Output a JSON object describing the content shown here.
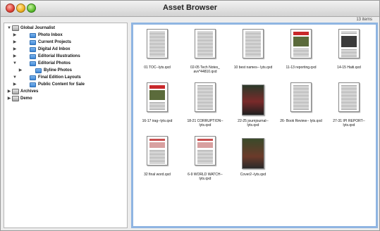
{
  "window": {
    "title": "Asset Browser",
    "item_count": "13 items"
  },
  "sidebar": {
    "items": [
      {
        "label": "Global Journalist",
        "type": "drive",
        "expanded": true,
        "indent": 0
      },
      {
        "label": "Photo Inbox",
        "type": "folder",
        "expanded": false,
        "indent": 1
      },
      {
        "label": "Current Projects",
        "type": "folder",
        "expanded": false,
        "indent": 1
      },
      {
        "label": "Digital Ad Inbox",
        "type": "folder",
        "expanded": false,
        "indent": 1
      },
      {
        "label": "Editorial Illustrations",
        "type": "folder",
        "expanded": false,
        "indent": 1
      },
      {
        "label": "Editorial Photos",
        "type": "folder",
        "expanded": true,
        "indent": 1
      },
      {
        "label": "Byline Photos",
        "type": "folder",
        "expanded": false,
        "indent": 2
      },
      {
        "label": "Final Edition Layouts",
        "type": "folder",
        "expanded": true,
        "indent": 1
      },
      {
        "label": "Public Content for Sale",
        "type": "folder",
        "expanded": false,
        "indent": 1
      },
      {
        "label": "Archives",
        "type": "drive",
        "expanded": false,
        "indent": 0
      },
      {
        "label": "Demo",
        "type": "drive",
        "expanded": false,
        "indent": 0
      }
    ]
  },
  "files": [
    {
      "name": "01 TOC--lyts.qxd",
      "kind": "text"
    },
    {
      "name": "02-05 Tech Notes_ avv*44810.qxd",
      "kind": "text"
    },
    {
      "name": "10 best names-- lyts.qxd",
      "kind": "text"
    },
    {
      "name": "11-13 reporting.qxd",
      "kind": "photo-red"
    },
    {
      "name": "14-15 Haiti.qxd",
      "kind": "photo"
    },
    {
      "name": "16-17 irag--lyts.qxd",
      "kind": "photo-red"
    },
    {
      "name": "18-21 CORRUPTION-- lyts.qxd",
      "kind": "text"
    },
    {
      "name": "22-25 journjournal-- lyts.qxd",
      "kind": "photo-dark"
    },
    {
      "name": "26- Book Review-- lyts.qxd",
      "kind": "text"
    },
    {
      "name": "27-31 IPI REPORT-- lyts.qxd",
      "kind": "text"
    },
    {
      "name": "32 final word.qxd",
      "kind": "text-red"
    },
    {
      "name": "6-9 WORLD WATCH-- lyts.qxd",
      "kind": "text-red"
    },
    {
      "name": "Cover2--lyts.qxd",
      "kind": "cover"
    }
  ]
}
